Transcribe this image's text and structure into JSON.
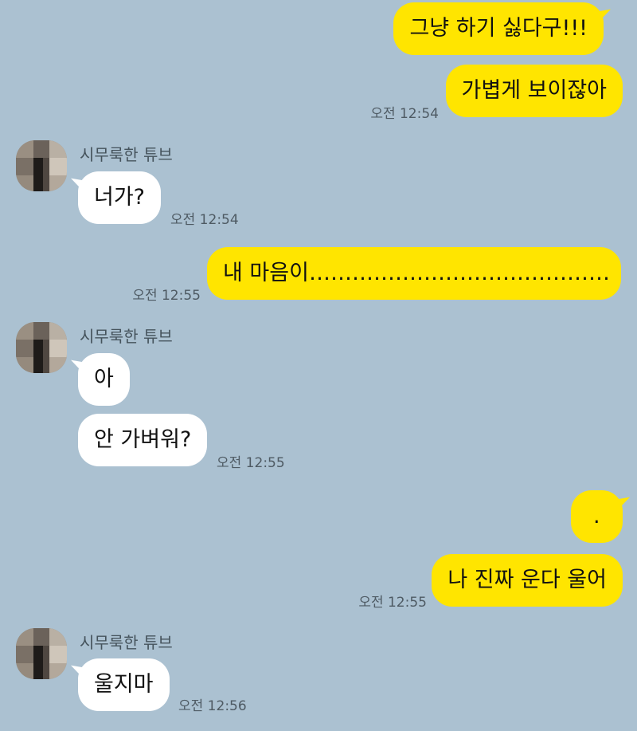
{
  "chat": {
    "contact_name": "시무룩한 튜브",
    "messages": [
      {
        "from": "me",
        "text": "그냥 하기 싫다구!!!"
      },
      {
        "from": "me",
        "text": "가볍게 보이잖아",
        "time": "오전 12:54"
      },
      {
        "from": "them",
        "text": "너가?",
        "time": "오전 12:54"
      },
      {
        "from": "me",
        "text": "내 마음이……………………………………",
        "time": "오전 12:55"
      },
      {
        "from": "them",
        "text": "아"
      },
      {
        "from": "them",
        "text": "안 가벼워?",
        "time": "오전 12:55"
      },
      {
        "from": "me",
        "text": "."
      },
      {
        "from": "me",
        "text": "나 진짜 운다 울어",
        "time": "오전 12:55"
      },
      {
        "from": "them",
        "text": "울지마",
        "time": "오전 12:56"
      }
    ]
  },
  "colors": {
    "background": "#abc1d1",
    "my_bubble": "#ffe500",
    "their_bubble": "#ffffff",
    "timestamp": "#4e5a63"
  },
  "icons": {
    "avatar": "blurred-profile-avatar"
  }
}
